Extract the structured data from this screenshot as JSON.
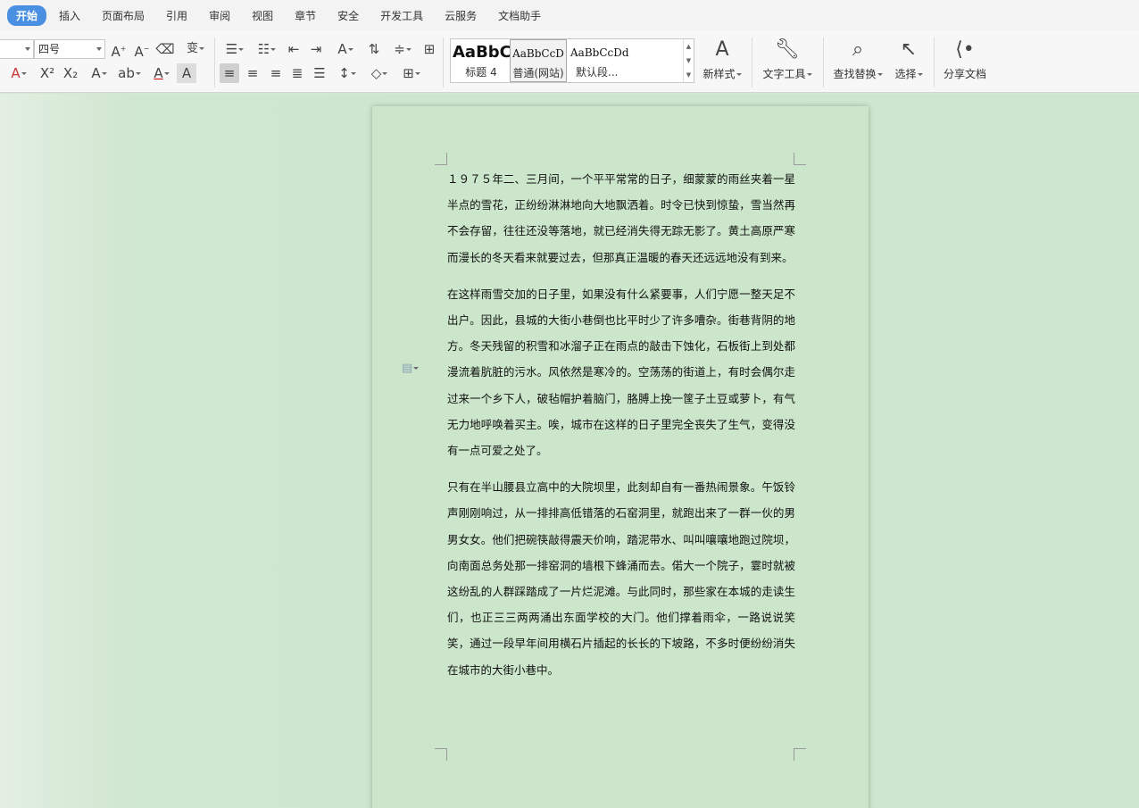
{
  "menu": {
    "tabs": [
      "开始",
      "插入",
      "页面布局",
      "引用",
      "审阅",
      "视图",
      "章节",
      "安全",
      "开发工具",
      "云服务",
      "文档助手"
    ],
    "active": "开始"
  },
  "ribbon": {
    "font_size": "四号",
    "styles": [
      {
        "preview": "AaBbC",
        "caption": "标题 4"
      },
      {
        "preview": "AaBbCcD",
        "caption": "普通(网站)"
      },
      {
        "preview": "AaBbCcDd",
        "caption": "默认段..."
      }
    ],
    "new_style_label": "新样式",
    "text_tools_label": "文字工具",
    "find_replace_label": "查找替换",
    "select_label": "选择",
    "share_label": "分享文档"
  },
  "document": {
    "paragraphs": [
      "１９７５年二、三月间，一个平平常常的日子，细蒙蒙的雨丝夹着一星半点的雪花，正纷纷淋淋地向大地飘洒着。时令已快到惊蛰，雪当然再不会存留，往往还没等落地，就已经消失得无踪无影了。黄土高原严寒而漫长的冬天看来就要过去，但那真正温暖的春天还远远地没有到来。",
      "在这样雨雪交加的日子里，如果没有什么紧要事，人们宁愿一整天足不出户。因此，县城的大街小巷倒也比平时少了许多嘈杂。街巷背阴的地方。冬天残留的积雪和冰溜子正在雨点的敲击下蚀化，石板街上到处都漫流着肮脏的污水。风依然是寒冷的。空荡荡的街道上，有时会偶尔走过来一个乡下人，破毡帽护着脑门，胳膊上挽一筐子土豆或萝卜，有气无力地呼唤着买主。唉，城市在这样的日子里完全丧失了生气，变得没有一点可爱之处了。",
      "只有在半山腰县立高中的大院坝里，此刻却自有一番热闹景象。午饭铃声刚刚响过，从一排排高低错落的石窑洞里，就跑出来了一群一伙的男男女女。他们把碗筷敲得震天价响，踏泥带水、叫叫嚷嚷地跑过院坝，向南面总务处那一排窑洞的墙根下蜂涌而去。偌大一个院子，霎时就被这纷乱的人群踩踏成了一片烂泥滩。与此同时，那些家在本城的走读生们，也正三三两两涌出东面学校的大门。他们撑着雨伞，一路说说笑笑，通过一段早年间用横石片插起的长长的下坡路，不多时便纷纷消失在城市的大街小巷中。"
    ]
  },
  "colors": {
    "active_tab": "#4a90e2",
    "page_bg": "#cce6cb",
    "workspace_bg": "#cde6cd"
  }
}
